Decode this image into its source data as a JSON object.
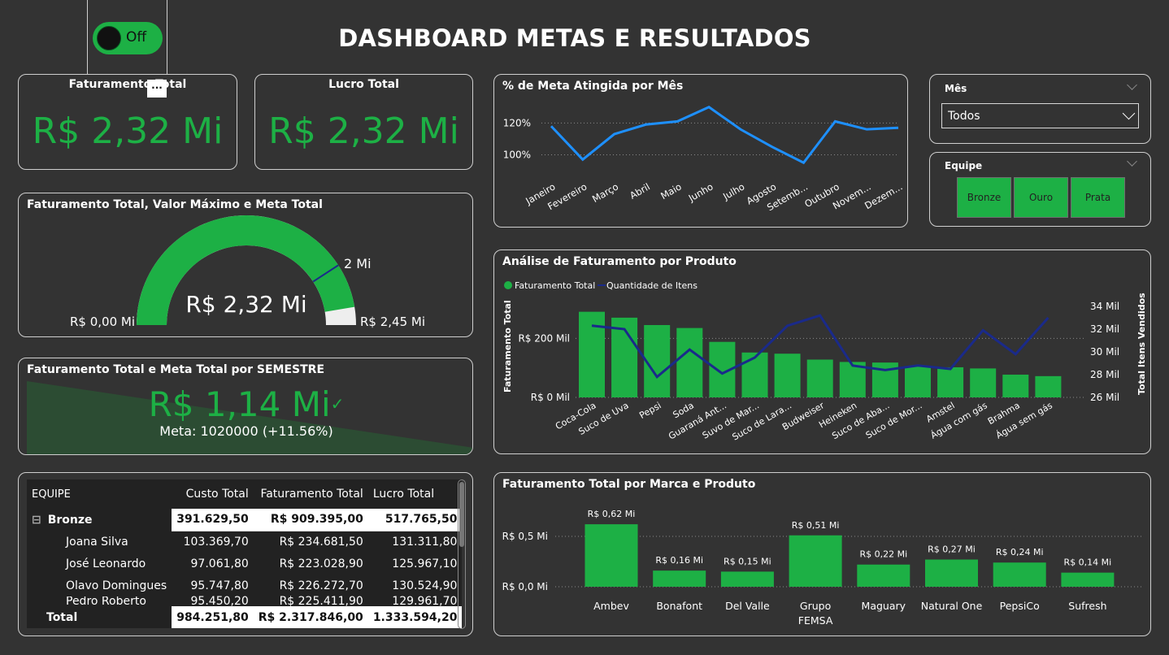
{
  "header": {
    "title": "DASHBOARD METAS E RESULTADOS",
    "toggle_label": "Off",
    "more_icon": "..."
  },
  "kpi_faturamento": {
    "title": "Faturamento Total",
    "value": "R$ 2,32 Mi"
  },
  "kpi_lucro": {
    "title": "Lucro Total",
    "value": "R$ 2,32 Mi"
  },
  "gauge": {
    "title": "Faturamento Total, Valor Máximo e Meta Total",
    "value_label": "R$ 2,32 Mi",
    "min_label": "R$ 0,00 Mi",
    "max_label": "R$ 2,45 Mi",
    "target_label": "2 Mi",
    "value": 2.32,
    "min": 0,
    "max": 2.45,
    "target": 2.0
  },
  "semestre": {
    "title": "Faturamento Total e Meta Total por SEMESTRE",
    "value": "R$ 1,14 Mi",
    "meta": "Meta: 1020000 (+11.56%)"
  },
  "table": {
    "headers": [
      "EQUIPE",
      "Custo Total",
      "Faturamento Total",
      "Lucro Total"
    ],
    "group": {
      "expand_icon": "⊟",
      "name": "Bronze",
      "custo": "391.629,50",
      "faturamento": "R$ 909.395,00",
      "lucro": "517.765,50"
    },
    "rows": [
      {
        "name": "Joana Silva",
        "custo": "103.369,70",
        "faturamento": "R$ 234.681,50",
        "lucro": "131.311,80"
      },
      {
        "name": "José Leonardo",
        "custo": "97.061,80",
        "faturamento": "R$ 223.028,90",
        "lucro": "125.967,10"
      },
      {
        "name": "Olavo Domingues",
        "custo": "95.747,80",
        "faturamento": "R$ 226.272,70",
        "lucro": "130.524,90"
      },
      {
        "name": "Pedro Roberto",
        "custo": "95.450,20",
        "faturamento": "R$ 225.411,90",
        "lucro": "129.961,70"
      }
    ],
    "total": {
      "name": "Total",
      "custo": "984.251,80",
      "faturamento": "R$ 2.317.846,00",
      "lucro": "1.333.594,20"
    }
  },
  "slicers": {
    "mes": {
      "label": "Mês",
      "value": "Todos"
    },
    "equipe": {
      "label": "Equipe",
      "options": [
        "Bronze",
        "Ouro",
        "Prata"
      ]
    }
  },
  "colors": {
    "green": "#1db045",
    "blue_line": "#1e90ff",
    "navy_line": "#1a2a8a",
    "background": "#333333"
  },
  "chart_data": [
    {
      "type": "line",
      "title": "% de Meta Atingida por Mês",
      "categories": [
        "Janeiro",
        "Fevereiro",
        "Março",
        "Abril",
        "Maio",
        "Junho",
        "Julho",
        "Agosto",
        "Setemb...",
        "Outubro",
        "Novem...",
        "Dezem..."
      ],
      "values": [
        118,
        97,
        113,
        119,
        121,
        130,
        116,
        105,
        95,
        121,
        116,
        117
      ],
      "yticks": [
        "100%",
        "120%"
      ],
      "ylim": [
        90,
        135
      ],
      "grid": true
    },
    {
      "type": "bar",
      "title": "Análise de Faturamento por Produto",
      "legend": [
        "Faturamento Total",
        "Quantidade de Itens"
      ],
      "ylabel": "Faturamento Total",
      "y2label": "Total Itens Vendidos",
      "categories": [
        "Coca-Cola",
        "Suco de Uva",
        "Pepsi",
        "Soda",
        "Guaraná Ant...",
        "Suvo de Mar...",
        "Suco de Lara...",
        "Budweiser",
        "Heineken",
        "Suco de Aba...",
        "Suco de Mor...",
        "Amstel",
        "Água com gás",
        "Brahma",
        "Água sem gás"
      ],
      "series": [
        {
          "name": "Faturamento Total",
          "axis": "left",
          "values": [
            290,
            270,
            245,
            235,
            188,
            152,
            148,
            128,
            120,
            118,
            105,
            102,
            98,
            77,
            72
          ]
        },
        {
          "name": "Quantidade de Itens",
          "axis": "right",
          "values": [
            32.3,
            32.0,
            27.8,
            30.2,
            28.1,
            29.5,
            32.3,
            33.2,
            28.8,
            28.4,
            28.8,
            28.5,
            31.9,
            29.8,
            33.0
          ]
        }
      ],
      "yticks": [
        "R$ 0 Mil",
        "R$ 200 Mil"
      ],
      "ylim": [
        0,
        300
      ],
      "y2ticks": [
        "26 Mil",
        "28 Mil",
        "30 Mil",
        "32 Mil",
        "34 Mil"
      ],
      "y2lim": [
        26,
        34
      ]
    },
    {
      "type": "bar",
      "title": "Faturamento Total por Marca e Produto",
      "categories": [
        "Ambev",
        "Bonafont",
        "Del Valle",
        "Grupo FEMSA",
        "Maguary",
        "Natural One",
        "PepsiCo",
        "Sufresh"
      ],
      "values": [
        0.62,
        0.16,
        0.15,
        0.51,
        0.22,
        0.27,
        0.24,
        0.14
      ],
      "data_labels": [
        "R$ 0,62 Mi",
        "R$ 0,16 Mi",
        "R$ 0,15 Mi",
        "R$ 0,51 Mi",
        "R$ 0,22 Mi",
        "R$ 0,27 Mi",
        "R$ 0,24 Mi",
        "R$ 0,14 Mi"
      ],
      "yticks": [
        "R$ 0,0 Mi",
        "R$ 0,5 Mi"
      ],
      "ylim": [
        0,
        0.5
      ]
    }
  ]
}
